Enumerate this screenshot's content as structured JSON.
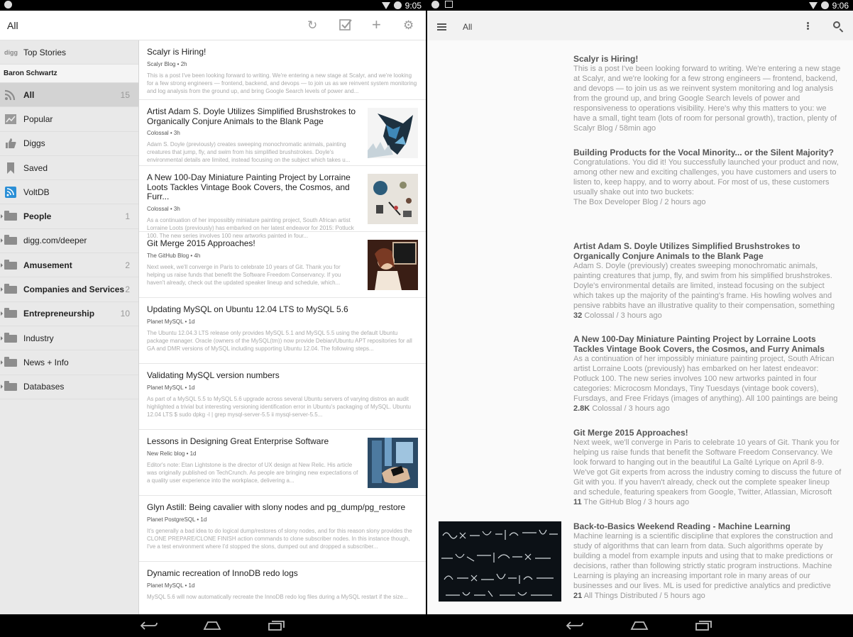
{
  "left": {
    "status_time": "9:05",
    "toolbar": {
      "title": "All",
      "icons": [
        "refresh-icon",
        "check-box-icon",
        "add-icon",
        "settings-icon"
      ]
    },
    "sidebar": {
      "top_stories": "Top Stories",
      "user": "Baron Schwartz",
      "items": [
        {
          "label": "All",
          "count": "15",
          "bold": true,
          "icon": "rss-icon"
        },
        {
          "label": "Popular",
          "count": "",
          "bold": false,
          "icon": "chart-icon"
        },
        {
          "label": "Diggs",
          "count": "",
          "bold": false,
          "icon": "thumbs-up-icon"
        },
        {
          "label": "Saved",
          "count": "",
          "bold": false,
          "icon": "bookmark-icon"
        },
        {
          "label": "VoltDB",
          "count": "",
          "bold": false,
          "icon": "feed-icon"
        },
        {
          "label": "People",
          "count": "1",
          "bold": true,
          "icon": "folder-icon"
        },
        {
          "label": "digg.com/deeper",
          "count": "",
          "bold": false,
          "icon": "folder-icon"
        },
        {
          "label": "Amusement",
          "count": "2",
          "bold": true,
          "icon": "folder-icon"
        },
        {
          "label": "Companies and Services",
          "count": "2",
          "bold": true,
          "icon": "folder-icon"
        },
        {
          "label": "Entrepreneurship",
          "count": "10",
          "bold": true,
          "icon": "folder-icon"
        },
        {
          "label": "Industry",
          "count": "",
          "bold": false,
          "icon": "folder-icon"
        },
        {
          "label": "News + Info",
          "count": "",
          "bold": false,
          "icon": "folder-icon"
        },
        {
          "label": "Databases",
          "count": "",
          "bold": false,
          "icon": "folder-icon"
        }
      ]
    },
    "feed": [
      {
        "title": "Scalyr is Hiring!",
        "meta": "Scalyr Blog • 2h",
        "snippet": "This is a post I've been looking forward to writing. We're entering a new stage at Scalyr, and we're looking for a few strong engineers — frontend, backend, and devops — to join us as we reinvent system monitoring and log analysis from the ground up, and bring Google Search levels of power and...",
        "thumb": ""
      },
      {
        "title": "Artist Adam S. Doyle Utilizes Simplified Brushstrokes to Organically Conjure Animals to the Blank Page",
        "meta": "Colossal • 3h",
        "snippet": "Adam S. Doyle (previously) creates sweeping monochromatic animals, painting creatures that jump, fly, and swim from his simplified brushstrokes. Doyle's environmental details are limited, instead focusing on the subject which takes u...",
        "thumb": "wolf"
      },
      {
        "title": "A New 100-Day Miniature Painting Project by Lorraine Loots Tackles Vintage Book Covers, the Cosmos, and Furr...",
        "meta": "Colossal • 3h",
        "snippet": "As a continuation of her impossibly miniature painting project, South African artist Lorraine Loots (previously) has embarked on her latest endeavor for 2015: Potluck 100. The new series involves 100 new artworks painted in four...",
        "thumb": "paint"
      },
      {
        "title": "Git Merge 2015 Approaches!",
        "meta": "The GitHub Blog • 4h",
        "snippet": "Next week, we'll converge in Paris to celebrate 10 years of Git. Thank you for helping us raise funds that benefit the Software Freedom Conservancy. If you haven't already, check out the updated speaker lineup and schedule, which...",
        "thumb": "git"
      },
      {
        "title": "Updating MySQL on Ubuntu 12.04 LTS to MySQL 5.6",
        "meta": "Planet MySQL • 1d",
        "snippet": "The Ubuntu 12.04.3 LTS release only provides MySQL 5.1 and MySQL 5.5 using the default Ubuntu package manager. Oracle (owners of the MySQL(tm)) now provide Debian/Ubuntu APT repositories for all GA and DMR versions of MySQL including supporting Ubuntu 12.04. The following steps...",
        "thumb": ""
      },
      {
        "title": "Validating MySQL version numbers",
        "meta": "Planet MySQL • 1d",
        "snippet": "As part of a MySQL 5.5 to MySQL 5.6 upgrade across several Ubuntu servers of varying distros an audit highlighted a trivial but interesting versioning identification error in Ubuntu's packaging of MySQL. Ubuntu 12.04 LTS $ sudo dpkg -l | grep mysql-server-5.5 ii mysql-server-5.5...",
        "thumb": ""
      },
      {
        "title": "Lessons in Designing Great Enterprise Software",
        "meta": "New Relic blog • 1d",
        "snippet": "Editor's note: Etan Lightstone is the director of UX design at New Relic. His article was originally published on TechCrunch. As people are bringing new expectations of a quality user experience into the workplace, delivering a...",
        "thumb": "phone"
      },
      {
        "title": "Glyn Astill: Being cavalier with slony nodes and pg_dump/pg_restore",
        "meta": "Planet PostgreSQL • 1d",
        "snippet": "It's generally a bad idea to do logical dump/restores of slony nodes, and for this reason slony provides the CLONE PREPARE/CLONE FINISH action commands to clone subscriber nodes. In this instance though, I've a test environment where I'd stopped the slons, dumped out and dropped a subscriber...",
        "thumb": ""
      },
      {
        "title": "Dynamic recreation of InnoDB redo logs",
        "meta": "Planet MySQL • 1d",
        "snippet": "MySQL 5.6 will now automatically recreate the InnoDB redo log files during a MySQL restart if the size...",
        "thumb": ""
      }
    ]
  },
  "right": {
    "status_time": "9:06",
    "toolbar": {
      "title": "All"
    },
    "articles": [
      {
        "title": "Scalyr is Hiring!",
        "body": "This is a post I've been looking forward to writing. We're entering a new stage at Scalyr, and we're looking for a few strong engineers — frontend, backend, and devops — to join us as we reinvent system monitoring and log analysis from the ground up, and bring Google Search levels of power and responsiveness to operations visibility. Here's why this matters to you: we have a small, tight team (lots of room for personal growth), traction, plenty of runway, a low-stress",
        "count": "",
        "source": "Scalyr Blog / 58min ago"
      },
      {
        "title": "Building Products for the Vocal Minority... or the Silent Majority?",
        "body": "Congratulations. You did it! You successfully launched your product and now, among other new and exciting challenges, you have customers and users to listen to, keep happy, and to worry about. For most of us, these customers usually shake out into two buckets:",
        "count": "",
        "source": "The Box Developer Blog / 2 hours ago"
      },
      {
        "title": "Artist Adam S. Doyle Utilizes Simplified Brushstrokes to Organically Conjure Animals to the Blank Page",
        "body": "Adam S. Doyle (previously) creates sweeping monochromatic animals, painting creatures that jump, fly, and swim from his simplified brushstrokes. Doyle's environmental details are limited, instead focusing on the subject which takes up the majority of the painting's frame. His howling wolves and pensive rabbits have an illustrative quality to their compensation, something that may stem",
        "count": "32",
        "source": "Colossal / 3 hours ago"
      },
      {
        "title": "A New 100-Day Miniature Painting Project by Lorraine Loots Tackles Vintage Book Covers, the Cosmos, and Furry Animals",
        "body": "As a continuation of her impossibly miniature painting project, South African artist Lorraine Loots (previously) has embarked on her latest endeavor: Potluck 100. The new series involves 100 new artworks painted in four categories: Microcosm Mondays, Tiny Tuesdays (vintage book covers), Fursdays, and Free Fridays (images of anything). All 100 paintings are being auctioned on her",
        "count": "2.8K",
        "source": "Colossal / 3 hours ago"
      },
      {
        "title": "Git Merge 2015 Approaches!",
        "body": "Next week, we'll converge in Paris to celebrate 10 years of Git. Thank you for helping us raise funds that benefit the Software Freedom Conservancy. We look forward to hanging out in the beautiful La Gaîté Lyrique on April 8-9. We've got Git experts from across the industry coming to discuss the future of Git with you. If you haven't already, check out the complete speaker lineup and schedule, featuring speakers from Google, Twitter, Atlassian, Microsoft and more. The",
        "count": "11",
        "source": "The GitHub Blog / 3 hours ago"
      },
      {
        "title": "Back-to-Basics Weekend Reading - Machine Learning",
        "body": "Machine learning is a scientific discipline that explores the construction and study of algorithms that can learn from data. Such algorithms operate by building a model from example inputs and using that to make predictions or decisions, rather than following strictly static program instructions. Machine Learning is playing an increasing important role in many areas of our businesses and our lives. ML is used for predictive analytics and predictive",
        "count": "21",
        "source": "All Things Distributed / 5 hours ago"
      }
    ]
  }
}
